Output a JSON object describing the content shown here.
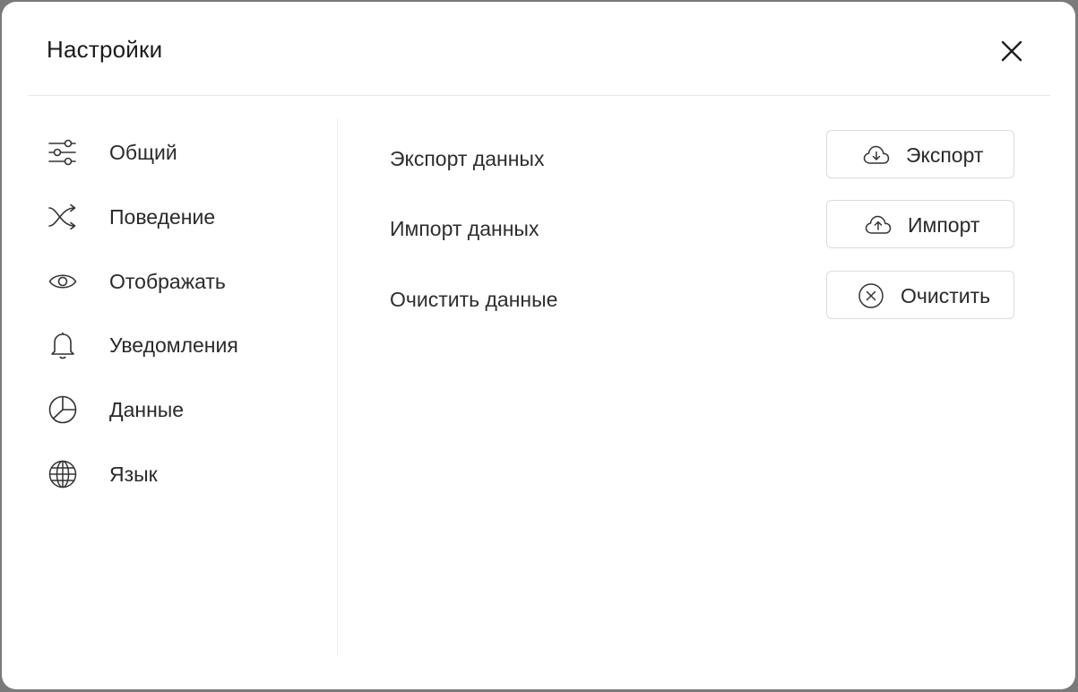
{
  "dialog": {
    "title": "Настройки",
    "close_icon": "close-icon"
  },
  "sidebar": {
    "items": [
      {
        "label": "Общий",
        "icon": "sliders-icon"
      },
      {
        "label": "Поведение",
        "icon": "shuffle-icon"
      },
      {
        "label": "Отображать",
        "icon": "eye-icon"
      },
      {
        "label": "Уведомления",
        "icon": "bell-icon"
      },
      {
        "label": "Данные",
        "icon": "pie-chart-icon"
      },
      {
        "label": "Язык",
        "icon": "globe-icon"
      }
    ]
  },
  "data_section": {
    "rows": [
      {
        "label": "Экспорт данных",
        "button_label": "Экспорт",
        "button_icon": "cloud-download-icon"
      },
      {
        "label": "Импорт данных",
        "button_label": "Импорт",
        "button_icon": "cloud-upload-icon"
      },
      {
        "label": "Очистить данные",
        "button_label": "Очистить",
        "button_icon": "circle-x-icon"
      }
    ]
  }
}
